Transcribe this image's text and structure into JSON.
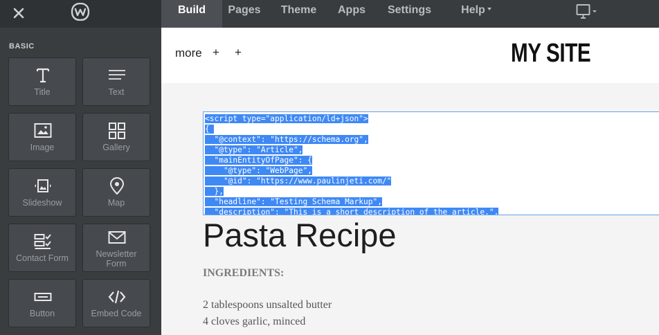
{
  "topbar": {
    "nav": [
      {
        "label": "Build",
        "active": true
      },
      {
        "label": "Pages"
      },
      {
        "label": "Theme"
      },
      {
        "label": "Apps"
      },
      {
        "label": "Settings"
      },
      {
        "label": "Help",
        "dropdown": true
      }
    ],
    "icons": {
      "close": "close-icon",
      "logo": "weebly-logo-icon",
      "device": "desktop-device-icon"
    }
  },
  "sidebar": {
    "section_label": "BASIC",
    "tiles": [
      {
        "label": "Title",
        "icon": "title-icon"
      },
      {
        "label": "Text",
        "icon": "text-icon"
      },
      {
        "label": "Image",
        "icon": "image-icon"
      },
      {
        "label": "Gallery",
        "icon": "gallery-icon"
      },
      {
        "label": "Slideshow",
        "icon": "slideshow-icon"
      },
      {
        "label": "Map",
        "icon": "map-pin-icon"
      },
      {
        "label": "Contact Form",
        "icon": "contact-form-icon"
      },
      {
        "label": "Newsletter Form",
        "icon": "envelope-icon"
      },
      {
        "label": "Button",
        "icon": "button-icon"
      },
      {
        "label": "Embed Code",
        "icon": "code-icon"
      }
    ]
  },
  "site": {
    "menu_more": "more",
    "plus": "+",
    "title": "MY SITE"
  },
  "code_block": {
    "lines": [
      "<script type=\"application/ld+json\">",
      "{ ",
      "  \"@context\": \"https://schema.org\",",
      "  \"@type\": \"Article\",",
      "  \"mainEntityOfPage\": {",
      "    \"@type\": \"WebPage\",",
      "    \"@id\": \"https://www.paulinjeti.com/\"",
      "  },",
      "  \"headline\": \"Testing Schema Markup\",",
      "  \"description\": \"This is a short description of the article.\","
    ]
  },
  "content": {
    "recipe_title": "Pasta Recipe",
    "ingredients_heading": "INGREDIENTS:",
    "ingredients": [
      "2 tablespoons unsalted butter",
      "4 cloves garlic, minced"
    ]
  },
  "colors": {
    "selection": "#3f89f5",
    "sidebar": "#3a3d40",
    "topbar": "#393c3f",
    "active_tab": "#4c5055"
  }
}
